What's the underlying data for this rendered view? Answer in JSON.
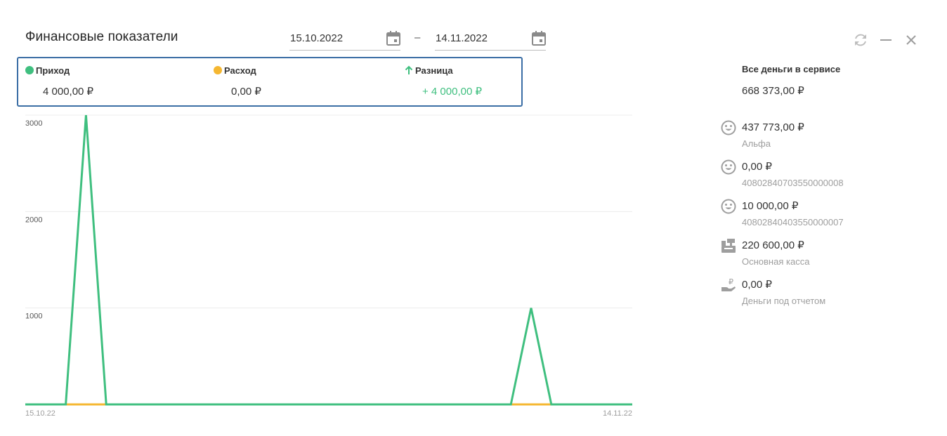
{
  "header": {
    "title": "Финансовые показатели",
    "date_from": "15.10.2022",
    "date_separator": "–",
    "date_to": "14.11.2022"
  },
  "summary": {
    "income_label": "Приход",
    "income_value": "4 000,00 ₽",
    "expense_label": "Расход",
    "expense_value": "0,00 ₽",
    "diff_label": "Разница",
    "diff_value": "+ 4 000,00 ₽"
  },
  "colors": {
    "income": "#3fbf7f",
    "expense": "#f5b731",
    "accent_border": "#3b6ea5",
    "icon_gray": "#9e9e9e"
  },
  "chart_data": {
    "type": "line",
    "x": [
      "15.10.22",
      "16.10.22",
      "17.10.22",
      "18.10.22",
      "19.10.22",
      "20.10.22",
      "21.10.22",
      "22.10.22",
      "23.10.22",
      "24.10.22",
      "25.10.22",
      "26.10.22",
      "27.10.22",
      "28.10.22",
      "29.10.22",
      "30.10.22",
      "31.10.22",
      "01.11.22",
      "02.11.22",
      "03.11.22",
      "04.11.22",
      "05.11.22",
      "06.11.22",
      "07.11.22",
      "08.11.22",
      "09.11.22",
      "10.11.22",
      "11.11.22",
      "12.11.22",
      "13.11.22",
      "14.11.22"
    ],
    "x_tick_labels": [
      "15.10.22",
      "14.11.22"
    ],
    "y_tick_labels": [
      "3000",
      "2000",
      "1000"
    ],
    "ylim": [
      0,
      3000
    ],
    "grid": true,
    "series": [
      {
        "name": "Приход",
        "color": "#3fbf7f",
        "values": [
          0,
          0,
          0,
          3000,
          0,
          0,
          0,
          0,
          0,
          0,
          0,
          0,
          0,
          0,
          0,
          0,
          0,
          0,
          0,
          0,
          0,
          0,
          0,
          0,
          0,
          1000,
          0,
          0,
          0,
          0,
          0
        ]
      },
      {
        "name": "Расход",
        "color": "#f5b731",
        "values": [
          0,
          0,
          0,
          0,
          0,
          0,
          0,
          0,
          0,
          0,
          0,
          0,
          0,
          0,
          0,
          0,
          0,
          0,
          0,
          0,
          0,
          0,
          0,
          0,
          0,
          0,
          0,
          0,
          0,
          0,
          0
        ]
      }
    ]
  },
  "sidebar": {
    "heading": "Все деньги в сервисе",
    "total": "668 373,00 ₽",
    "accounts": [
      {
        "icon": "smiley-icon",
        "amount": "437 773,00 ₽",
        "name": "Альфа"
      },
      {
        "icon": "smiley-icon",
        "amount": "0,00 ₽",
        "name": "40802840703550000008"
      },
      {
        "icon": "smiley-icon",
        "amount": "10 000,00 ₽",
        "name": "40802840403550000007"
      },
      {
        "icon": "cash-register-icon",
        "amount": "220 600,00 ₽",
        "name": "Основная касса"
      },
      {
        "icon": "money-hand-icon",
        "amount": "0,00 ₽",
        "name": "Деньги под отчетом"
      }
    ]
  }
}
